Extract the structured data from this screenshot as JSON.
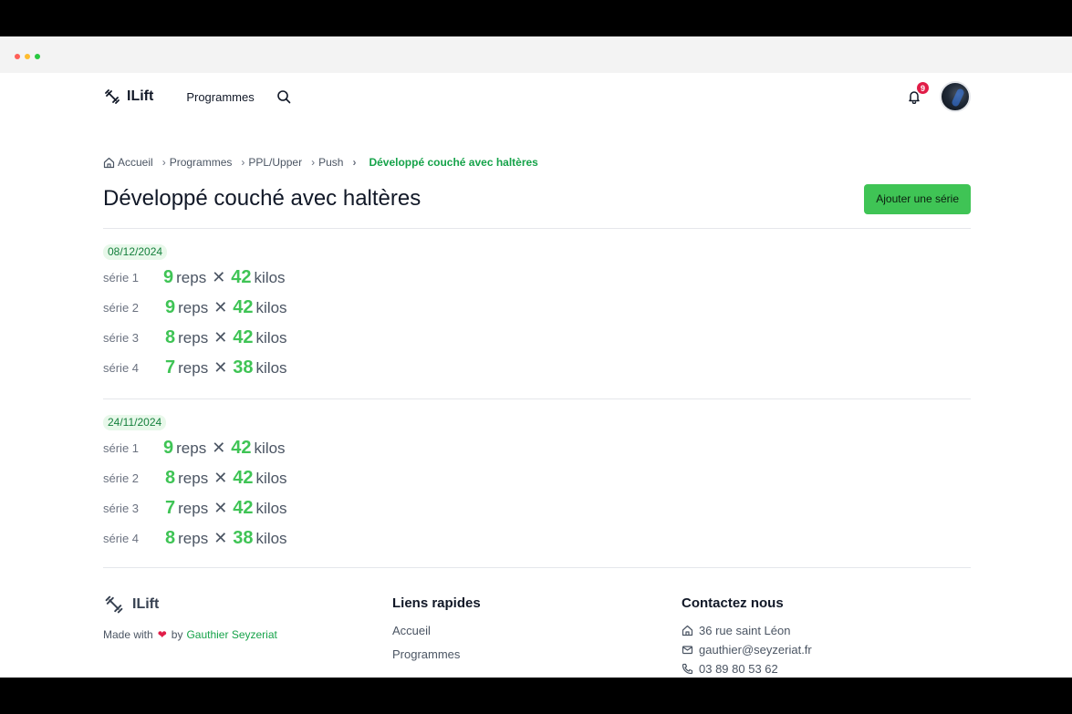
{
  "app": {
    "name": "ILift"
  },
  "nav": {
    "programmes": "Programmes",
    "notifications_count": "9"
  },
  "breadcrumb": [
    "Accueil",
    "Programmes",
    "PPL/Upper",
    "Push",
    "Développé couché avec haltères"
  ],
  "page": {
    "title": "Développé couché avec haltères",
    "add_button": "Ajouter une série"
  },
  "units": {
    "reps": "reps",
    "kilos": "kilos",
    "times": "✕"
  },
  "sessions": [
    {
      "date": "08/12/2024",
      "sets": [
        {
          "label": "série 1",
          "reps": "9",
          "weight": "42"
        },
        {
          "label": "série 2",
          "reps": "9",
          "weight": "42"
        },
        {
          "label": "série 3",
          "reps": "8",
          "weight": "42"
        },
        {
          "label": "série 4",
          "reps": "7",
          "weight": "38"
        }
      ]
    },
    {
      "date": "24/11/2024",
      "sets": [
        {
          "label": "série 1",
          "reps": "9",
          "weight": "42"
        },
        {
          "label": "série 2",
          "reps": "8",
          "weight": "42"
        },
        {
          "label": "série 3",
          "reps": "7",
          "weight": "42"
        },
        {
          "label": "série 4",
          "reps": "8",
          "weight": "38"
        }
      ]
    }
  ],
  "footer": {
    "brand": "ILift",
    "made_with": "Made with",
    "by": "by",
    "author": "Gauthier Seyzeriat",
    "links_title": "Liens rapides",
    "links": [
      "Accueil",
      "Programmes"
    ],
    "contact_title": "Contactez nous",
    "address": "36 rue saint Léon",
    "email": "gauthier@seyzeriat.fr",
    "phone": "03 89 80 53 62"
  },
  "colors": {
    "accent": "#3fc455",
    "badge": "#e11d48"
  }
}
